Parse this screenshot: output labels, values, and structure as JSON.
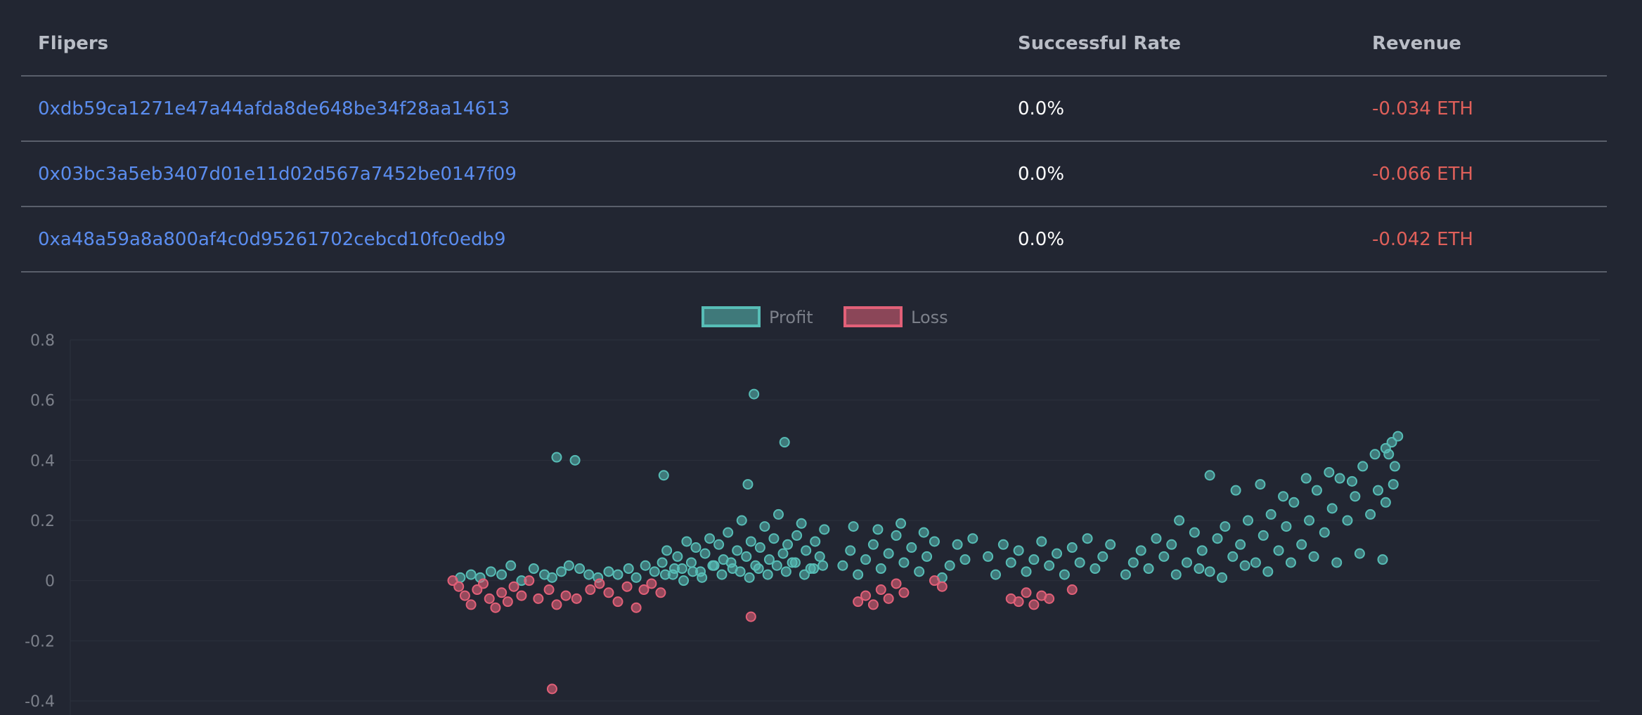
{
  "table": {
    "headers": [
      "Flipers",
      "Successful Rate",
      "Revenue"
    ],
    "rows": [
      {
        "address": "0xdb59ca1271e47a44afda8de648be34f28aa14613",
        "rate": "0.0%",
        "revenue": "-0.034 ETH"
      },
      {
        "address": "0x03bc3a5eb3407d01e11d02d567a7452be0147f09",
        "rate": "0.0%",
        "revenue": "-0.066 ETH"
      },
      {
        "address": "0xa48a59a8a800af4c0d95261702cebcd10fc0edb9",
        "rate": "0.0%",
        "revenue": "-0.042 ETH"
      }
    ]
  },
  "colors": {
    "profit": "#57bdb6",
    "loss": "#e26078",
    "link": "#5b8def",
    "negative": "#e0605a"
  },
  "chart_data": {
    "type": "scatter",
    "legend": [
      "Profit",
      "Loss"
    ],
    "legend_position": "top-center",
    "ylim": [
      -0.4,
      0.8
    ],
    "yticks": [
      "0.8",
      "0.6",
      "0.4",
      "0.2",
      "0",
      "-0.2",
      "-0.4"
    ],
    "xlim": [
      0,
      100
    ],
    "grid": true,
    "series": [
      {
        "name": "Profit",
        "points": [
          [
            25.5,
            0.01
          ],
          [
            26.2,
            0.02
          ],
          [
            26.8,
            0.01
          ],
          [
            27.5,
            0.03
          ],
          [
            28.2,
            0.02
          ],
          [
            28.8,
            0.05
          ],
          [
            29.5,
            0.0
          ],
          [
            30.3,
            0.04
          ],
          [
            31.0,
            0.02
          ],
          [
            31.5,
            0.01
          ],
          [
            32.1,
            0.03
          ],
          [
            32.6,
            0.05
          ],
          [
            33.3,
            0.04
          ],
          [
            33.9,
            0.02
          ],
          [
            34.5,
            0.01
          ],
          [
            35.2,
            0.03
          ],
          [
            35.8,
            0.02
          ],
          [
            36.5,
            0.04
          ],
          [
            37.0,
            0.01
          ],
          [
            37.6,
            0.05
          ],
          [
            38.2,
            0.03
          ],
          [
            31.8,
            0.41
          ],
          [
            33.0,
            0.4
          ],
          [
            38.8,
            0.35
          ],
          [
            44.3,
            0.32
          ],
          [
            44.7,
            0.62
          ],
          [
            46.7,
            0.46
          ],
          [
            74.5,
            0.35
          ],
          [
            38.7,
            0.06
          ],
          [
            39.0,
            0.1
          ],
          [
            39.4,
            0.02
          ],
          [
            39.7,
            0.08
          ],
          [
            40.0,
            0.04
          ],
          [
            40.3,
            0.13
          ],
          [
            40.6,
            0.06
          ],
          [
            40.9,
            0.11
          ],
          [
            41.2,
            0.03
          ],
          [
            41.5,
            0.09
          ],
          [
            41.8,
            0.14
          ],
          [
            42.1,
            0.05
          ],
          [
            42.4,
            0.12
          ],
          [
            42.7,
            0.07
          ],
          [
            43.0,
            0.16
          ],
          [
            43.3,
            0.04
          ],
          [
            43.6,
            0.1
          ],
          [
            43.9,
            0.2
          ],
          [
            44.2,
            0.08
          ],
          [
            44.5,
            0.13
          ],
          [
            44.8,
            0.05
          ],
          [
            45.1,
            0.11
          ],
          [
            45.4,
            0.18
          ],
          [
            45.7,
            0.07
          ],
          [
            46.0,
            0.14
          ],
          [
            46.3,
            0.22
          ],
          [
            46.6,
            0.09
          ],
          [
            46.9,
            0.12
          ],
          [
            47.2,
            0.06
          ],
          [
            47.5,
            0.15
          ],
          [
            47.8,
            0.19
          ],
          [
            48.1,
            0.1
          ],
          [
            48.4,
            0.04
          ],
          [
            48.7,
            0.13
          ],
          [
            49.0,
            0.08
          ],
          [
            49.3,
            0.17
          ],
          [
            38.9,
            0.02
          ],
          [
            39.5,
            0.04
          ],
          [
            40.1,
            0.0
          ],
          [
            40.7,
            0.03
          ],
          [
            41.3,
            0.01
          ],
          [
            42.0,
            0.05
          ],
          [
            42.6,
            0.02
          ],
          [
            43.2,
            0.06
          ],
          [
            43.8,
            0.03
          ],
          [
            44.4,
            0.01
          ],
          [
            45.0,
            0.04
          ],
          [
            45.6,
            0.02
          ],
          [
            46.2,
            0.05
          ],
          [
            46.8,
            0.03
          ],
          [
            47.4,
            0.06
          ],
          [
            48.0,
            0.02
          ],
          [
            48.6,
            0.04
          ],
          [
            49.2,
            0.05
          ],
          [
            50.5,
            0.05
          ],
          [
            51.0,
            0.1
          ],
          [
            51.5,
            0.02
          ],
          [
            52.0,
            0.07
          ],
          [
            52.5,
            0.12
          ],
          [
            53.0,
            0.04
          ],
          [
            53.5,
            0.09
          ],
          [
            54.0,
            0.15
          ],
          [
            54.5,
            0.06
          ],
          [
            55.0,
            0.11
          ],
          [
            55.5,
            0.03
          ],
          [
            56.0,
            0.08
          ],
          [
            56.5,
            0.13
          ],
          [
            57.0,
            0.01
          ],
          [
            57.5,
            0.05
          ],
          [
            58.0,
            0.12
          ],
          [
            58.5,
            0.07
          ],
          [
            59.0,
            0.14
          ],
          [
            51.2,
            0.18
          ],
          [
            52.8,
            0.17
          ],
          [
            54.3,
            0.19
          ],
          [
            55.8,
            0.16
          ],
          [
            60.0,
            0.08
          ],
          [
            60.5,
            0.02
          ],
          [
            61.0,
            0.12
          ],
          [
            61.5,
            0.06
          ],
          [
            62.0,
            0.1
          ],
          [
            62.5,
            0.03
          ],
          [
            63.0,
            0.07
          ],
          [
            63.5,
            0.13
          ],
          [
            64.0,
            0.05
          ],
          [
            64.5,
            0.09
          ],
          [
            65.0,
            0.02
          ],
          [
            65.5,
            0.11
          ],
          [
            66.0,
            0.06
          ],
          [
            66.5,
            0.14
          ],
          [
            67.0,
            0.04
          ],
          [
            67.5,
            0.08
          ],
          [
            68.0,
            0.12
          ],
          [
            69.0,
            0.02
          ],
          [
            69.5,
            0.06
          ],
          [
            70.0,
            0.1
          ],
          [
            70.5,
            0.04
          ],
          [
            71.0,
            0.14
          ],
          [
            71.5,
            0.08
          ],
          [
            72.0,
            0.12
          ],
          [
            72.5,
            0.2
          ],
          [
            73.0,
            0.06
          ],
          [
            73.5,
            0.16
          ],
          [
            74.0,
            0.1
          ],
          [
            74.5,
            0.03
          ],
          [
            75.0,
            0.14
          ],
          [
            75.5,
            0.18
          ],
          [
            76.0,
            0.08
          ],
          [
            76.5,
            0.12
          ],
          [
            77.0,
            0.2
          ],
          [
            77.5,
            0.06
          ],
          [
            78.0,
            0.15
          ],
          [
            78.5,
            0.22
          ],
          [
            79.0,
            0.1
          ],
          [
            79.5,
            0.18
          ],
          [
            80.0,
            0.26
          ],
          [
            80.5,
            0.12
          ],
          [
            81.0,
            0.2
          ],
          [
            81.5,
            0.3
          ],
          [
            82.0,
            0.16
          ],
          [
            82.5,
            0.24
          ],
          [
            83.0,
            0.34
          ],
          [
            83.5,
            0.2
          ],
          [
            84.0,
            0.28
          ],
          [
            84.5,
            0.38
          ],
          [
            85.0,
            0.22
          ],
          [
            85.5,
            0.3
          ],
          [
            86.0,
            0.26
          ],
          [
            86.5,
            0.32
          ],
          [
            76.2,
            0.3
          ],
          [
            77.8,
            0.32
          ],
          [
            79.3,
            0.28
          ],
          [
            80.8,
            0.34
          ],
          [
            82.3,
            0.36
          ],
          [
            83.8,
            0.33
          ],
          [
            85.3,
            0.42
          ],
          [
            86.0,
            0.44
          ],
          [
            86.4,
            0.46
          ],
          [
            86.8,
            0.48
          ],
          [
            86.2,
            0.42
          ],
          [
            86.6,
            0.38
          ],
          [
            72.3,
            0.02
          ],
          [
            73.8,
            0.04
          ],
          [
            75.3,
            0.01
          ],
          [
            76.8,
            0.05
          ],
          [
            78.3,
            0.03
          ],
          [
            79.8,
            0.06
          ],
          [
            81.3,
            0.08
          ],
          [
            82.8,
            0.06
          ],
          [
            84.3,
            0.09
          ],
          [
            85.8,
            0.07
          ]
        ]
      },
      {
        "name": "Loss",
        "points": [
          [
            25.0,
            0.0
          ],
          [
            25.4,
            -0.02
          ],
          [
            25.8,
            -0.05
          ],
          [
            26.2,
            -0.08
          ],
          [
            26.6,
            -0.03
          ],
          [
            27.0,
            -0.01
          ],
          [
            27.4,
            -0.06
          ],
          [
            27.8,
            -0.09
          ],
          [
            28.2,
            -0.04
          ],
          [
            28.6,
            -0.07
          ],
          [
            29.0,
            -0.02
          ],
          [
            29.5,
            -0.05
          ],
          [
            30.0,
            0.0
          ],
          [
            30.6,
            -0.06
          ],
          [
            31.3,
            -0.03
          ],
          [
            31.8,
            -0.08
          ],
          [
            32.4,
            -0.05
          ],
          [
            33.1,
            -0.06
          ],
          [
            34.0,
            -0.03
          ],
          [
            34.6,
            -0.01
          ],
          [
            35.2,
            -0.04
          ],
          [
            35.8,
            -0.07
          ],
          [
            36.4,
            -0.02
          ],
          [
            37.0,
            -0.09
          ],
          [
            37.5,
            -0.03
          ],
          [
            38.0,
            -0.01
          ],
          [
            38.6,
            -0.04
          ],
          [
            31.5,
            -0.36
          ],
          [
            44.5,
            -0.12
          ],
          [
            51.5,
            -0.07
          ],
          [
            52.0,
            -0.05
          ],
          [
            52.5,
            -0.08
          ],
          [
            53.0,
            -0.03
          ],
          [
            53.5,
            -0.06
          ],
          [
            54.0,
            -0.01
          ],
          [
            54.5,
            -0.04
          ],
          [
            56.5,
            0.0
          ],
          [
            57.0,
            -0.02
          ],
          [
            61.5,
            -0.06
          ],
          [
            62.0,
            -0.07
          ],
          [
            62.5,
            -0.04
          ],
          [
            63.0,
            -0.08
          ],
          [
            63.5,
            -0.05
          ],
          [
            64.0,
            -0.06
          ],
          [
            65.5,
            -0.03
          ]
        ]
      }
    ]
  }
}
